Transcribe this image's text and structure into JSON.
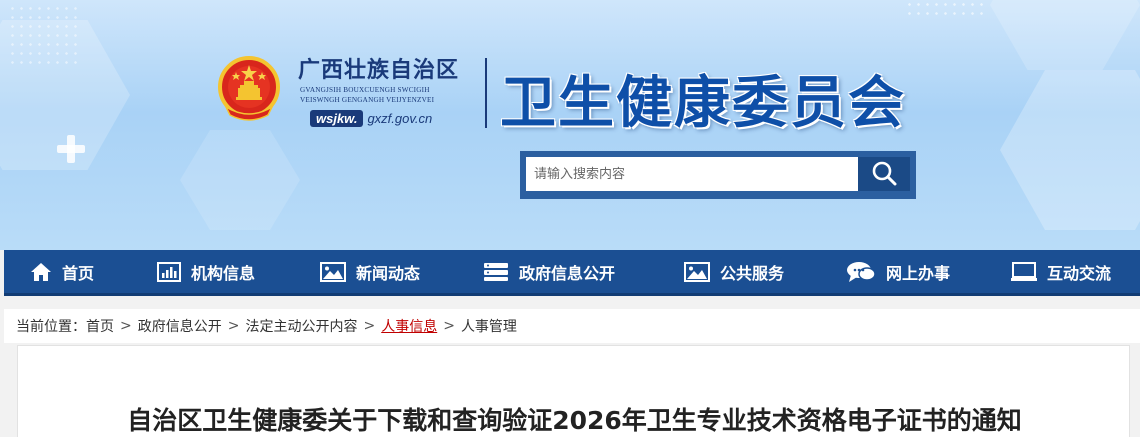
{
  "header": {
    "region_cn": "广西壮族自治区",
    "region_zhuang_line1": "GVANGJSIH BOUXCUENGH SWCIGIH",
    "region_zhuang_line2": "VEISWNGH GENGANGH VEIJYENZVEI",
    "site_prefix": "wsjkw.",
    "site_domain": "gxzf.gov.cn",
    "org_title": "卫生健康委员会",
    "emblem_icon": "national-emblem-icon"
  },
  "search": {
    "placeholder": "请输入搜索内容",
    "value": "",
    "button_icon": "search-icon"
  },
  "nav": {
    "items": [
      {
        "label": "首页",
        "icon": "home-icon"
      },
      {
        "label": "机构信息",
        "icon": "bar-chart-icon"
      },
      {
        "label": "新闻动态",
        "icon": "image-icon"
      },
      {
        "label": "政府信息公开",
        "icon": "server-icon"
      },
      {
        "label": "公共服务",
        "icon": "image-icon"
      },
      {
        "label": "网上办事",
        "icon": "chat-icon"
      },
      {
        "label": "互动交流",
        "icon": "monitor-icon"
      }
    ]
  },
  "breadcrumb": {
    "prefix": "当前位置：",
    "items": [
      "首页",
      "政府信息公开",
      "法定主动公开内容",
      "人事信息",
      "人事管理"
    ],
    "separator": ">"
  },
  "article": {
    "title": "自治区卫生健康委关于下载和查询验证2026年卫生专业技术资格电子证书的通知"
  },
  "colors": {
    "nav_bg": "#1b4f93",
    "title_blue": "#0e4fa8",
    "active_crumb": "#c00000"
  }
}
